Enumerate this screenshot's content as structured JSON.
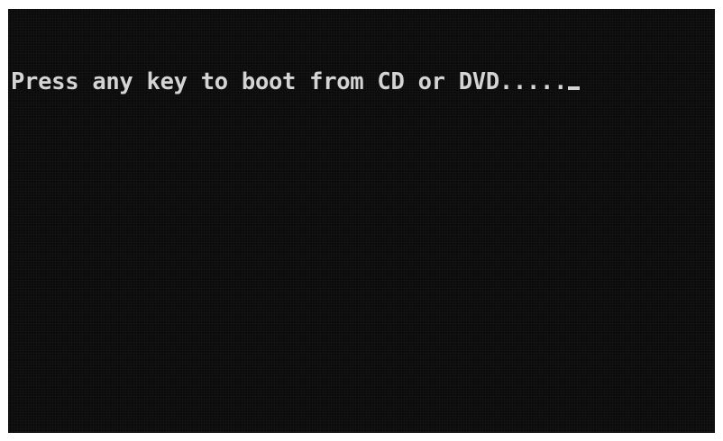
{
  "console": {
    "message": "Press any key to boot from CD or DVD.....",
    "text_color": "#d4d4d4",
    "background_color": "#0b0b0b",
    "cursor": "blinking-underscore-cursor"
  }
}
